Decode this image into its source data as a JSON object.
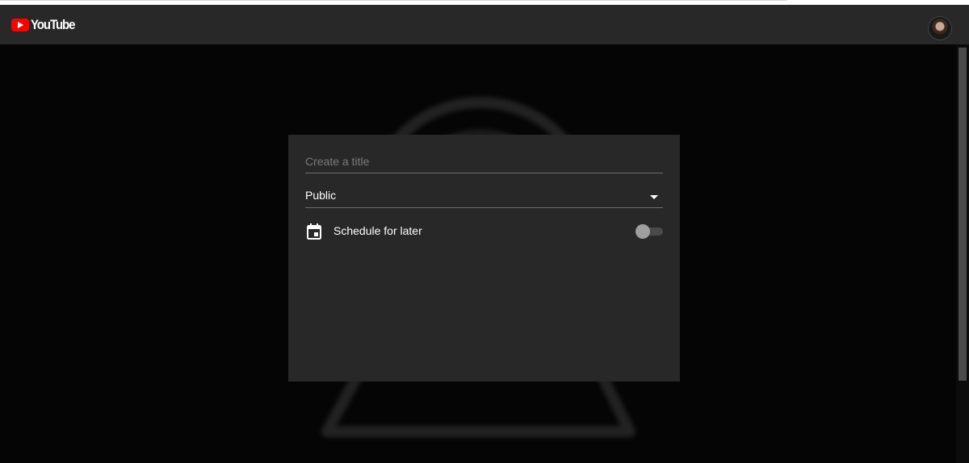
{
  "masthead": {
    "logo_text": "YouTube",
    "logo_icon": "youtube-play-icon",
    "avatar_icon": "user-avatar"
  },
  "dialog": {
    "title_placeholder": "Create a title",
    "title_value": "",
    "privacy": {
      "selected": "Public",
      "icon": "chevron-down-icon"
    },
    "schedule": {
      "label": "Schedule for later",
      "icon": "calendar-icon",
      "enabled": false
    }
  },
  "colors": {
    "background": "#050505",
    "masthead": "#282828",
    "dialog": "#282828",
    "brand_red": "#ff0000",
    "text": "#ffffff",
    "placeholder": "#7a7a7a",
    "toggle_off_knob": "#9e9e9e",
    "toggle_off_track": "#4a4a4a"
  }
}
